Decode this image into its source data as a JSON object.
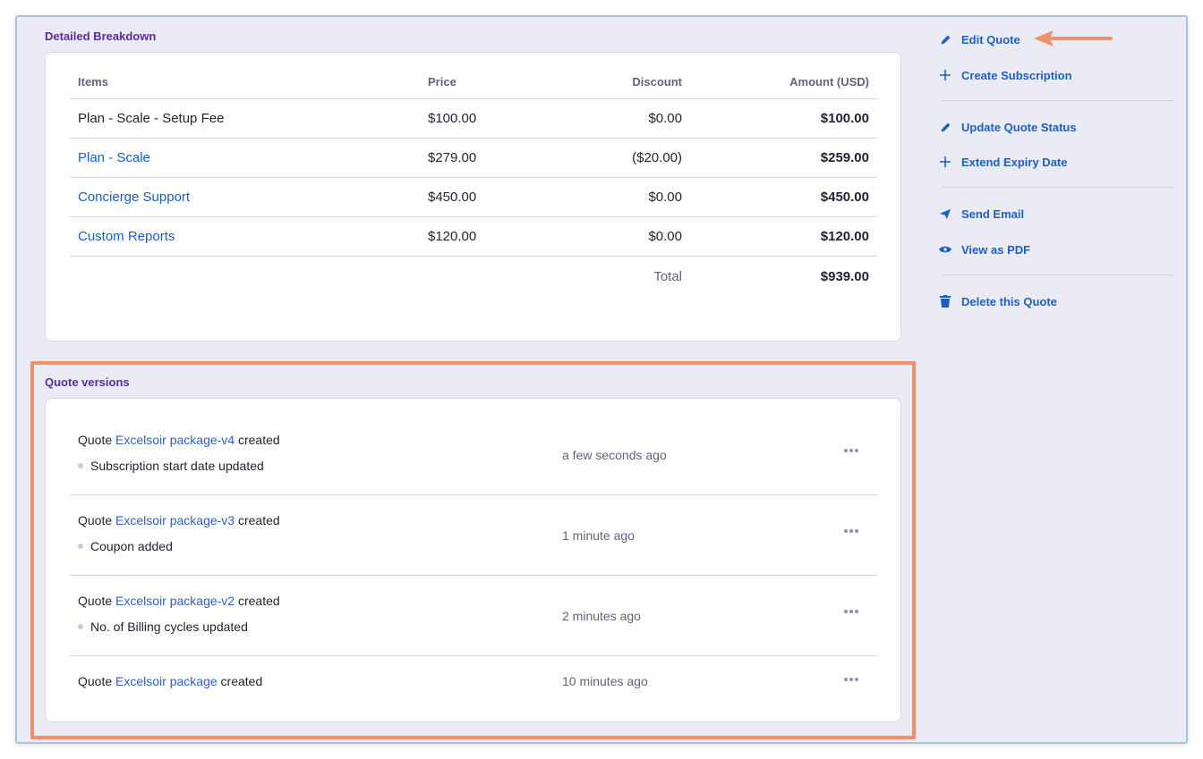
{
  "breakdown": {
    "title": "Detailed Breakdown",
    "headers": {
      "items": "Items",
      "price": "Price",
      "discount": "Discount",
      "amount": "Amount (USD)"
    },
    "rows": [
      {
        "item": "Plan - Scale - Setup Fee",
        "price": "$100.00",
        "discount": "$0.00",
        "amount": "$100.00"
      },
      {
        "item": "Plan - Scale",
        "price": "$279.00",
        "discount": "($20.00)",
        "amount": "$259.00"
      },
      {
        "item": "Concierge Support",
        "price": "$450.00",
        "discount": "$0.00",
        "amount": "$450.00"
      },
      {
        "item": "Custom Reports",
        "price": "$120.00",
        "discount": "$0.00",
        "amount": "$120.00"
      }
    ],
    "total_label": "Total",
    "total_value": "$939.00"
  },
  "versions": {
    "title": "Quote versions",
    "prefix": "Quote",
    "suffix": "created",
    "items": [
      {
        "name": "Excelsoir package-v4",
        "change": "Subscription start date updated",
        "time": "a few seconds ago"
      },
      {
        "name": "Excelsoir package-v3",
        "change": "Coupon added",
        "time": "1 minute ago"
      },
      {
        "name": "Excelsoir package-v2",
        "change": "No. of Billing cycles updated",
        "time": "2 minutes ago"
      },
      {
        "name": "Excelsoir package",
        "change": "",
        "time": "10 minutes ago"
      }
    ]
  },
  "actions": {
    "edit_quote": "Edit Quote",
    "create_subscription": "Create Subscription",
    "update_quote_status": "Update Quote Status",
    "extend_expiry_date": "Extend Expiry Date",
    "send_email": "Send Email",
    "view_as_pdf": "View as PDF",
    "delete_quote": "Delete this Quote"
  },
  "icons": {
    "edit": "pencil-icon",
    "create": "plus-icon",
    "update": "pencil-icon",
    "extend": "plus-icon",
    "email": "paper-plane-icon",
    "pdf": "eye-icon",
    "delete": "trash-icon",
    "more": "more-horizontal-icon"
  },
  "colors": {
    "link": "#1b5fc4",
    "section_title": "#5a2ca0",
    "highlight": "#f0906d",
    "background": "#ebebf5"
  }
}
